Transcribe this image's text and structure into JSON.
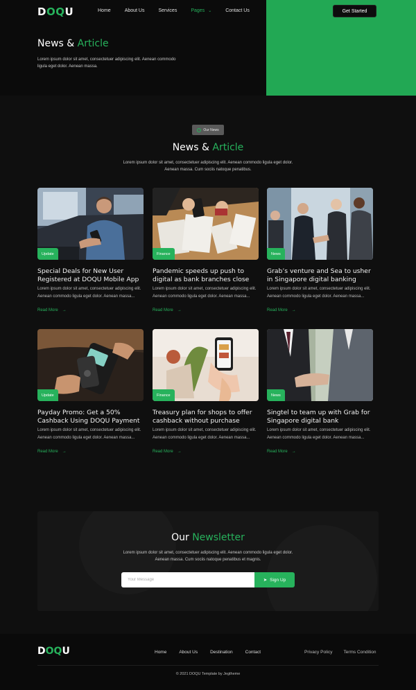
{
  "brand": {
    "logo_prefix": "D",
    "logo_accent": "OQ",
    "logo_suffix": "U"
  },
  "nav": {
    "items": [
      "Home",
      "About Us",
      "Services",
      "Pages",
      "Contact Us"
    ],
    "active": "Pages",
    "cta": "Get Started"
  },
  "hero": {
    "title_main": "News",
    "title_amp": " & ",
    "title_accent": "Article",
    "description": "Lorem ipsum dolor sit amet, consectetuer adipiscing elit. Aenean commodo ligula eget dolor. Aenean massa."
  },
  "section": {
    "badge": "Our News",
    "title_main": "News",
    "title_amp": " & ",
    "title_accent": "Article",
    "description": "Lorem ipsum dolor sit amet, consectetuer adipiscing elit. Aenean commodo ligula eget dolor. Aenean massa. Cum sociis natoque penatibus."
  },
  "cards": [
    {
      "tag": "Update",
      "title": "Special Deals for New User Registered at DOQU Mobile App",
      "desc": "Lorem ipsum dolor sit amet, consectetuer adipiscing elit. Aenean commodo ligula eget dolor. Aenean massa...",
      "link": "Read More"
    },
    {
      "tag": "Finance",
      "title": "Pandemic speeds up push to digital as bank branches close",
      "desc": "Lorem ipsum dolor sit amet, consectetuer adipiscing elit. Aenean commodo ligula eget dolor. Aenean massa...",
      "link": "Read More"
    },
    {
      "tag": "News",
      "title": "Grab’s venture and Sea to usher in Singapore digital banking",
      "desc": "Lorem ipsum dolor sit amet, consectetuer adipiscing elit. Aenean commodo ligula eget dolor. Aenean massa...",
      "link": "Read More"
    },
    {
      "tag": "Update",
      "title": "Payday Promo: Get a 50% Cashback Using DOQU Payment",
      "desc": "Lorem ipsum dolor sit amet, consectetuer adipiscing elit. Aenean commodo ligula eget dolor. Aenean massa...",
      "link": "Read More"
    },
    {
      "tag": "Finance",
      "title": "Treasury plan for shops to offer cashback without purchase",
      "desc": "Lorem ipsum dolor sit amet, consectetuer adipiscing elit. Aenean commodo ligula eget dolor. Aenean massa...",
      "link": "Read More"
    },
    {
      "tag": "News",
      "title": "Singtel to team up with Grab for Singapore digital bank",
      "desc": "Lorem ipsum dolor sit amet, consectetuer adipiscing elit. Aenean commodo ligula eget dolor. Aenean massa...",
      "link": "Read More"
    }
  ],
  "newsletter": {
    "title_main": "Our",
    "title_accent": "Newsletter",
    "description": "Lorem ipsum dolor sit amet, consectetuer adipiscing elit. Aenean commodo ligula eget dolor. Aenean massa. Cum sociis natoque penatibus et magnis.",
    "placeholder": "Your Message",
    "button": "Sign Up"
  },
  "footer": {
    "nav": [
      "Home",
      "About Us",
      "Destination",
      "Contact"
    ],
    "legal": [
      "Privacy Policy",
      "Terms Condition"
    ],
    "copyright": "© 2021 DOQU Template by Jegtheme"
  },
  "colors": {
    "accent": "#27b25c",
    "background": "#0f0f0f"
  }
}
